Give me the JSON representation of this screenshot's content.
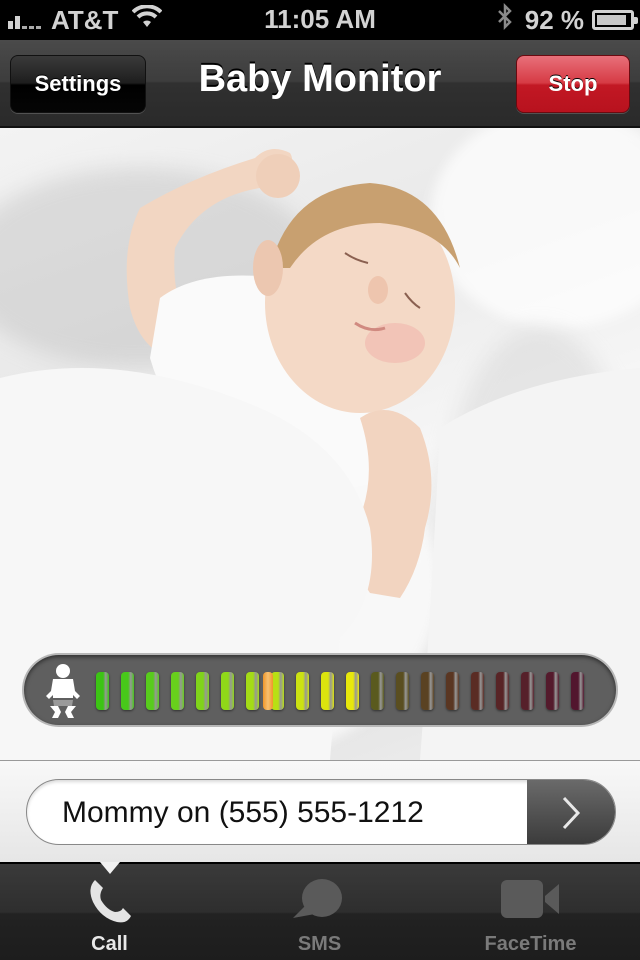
{
  "status_bar": {
    "carrier": "AT&T",
    "signal_bars_active": 2,
    "signal_bars_total": 5,
    "time": "11:05 AM",
    "battery_percent_label": "92 %",
    "battery_level": 0.92,
    "icons": [
      "signal-icon",
      "wifi-icon",
      "bluetooth-icon",
      "battery-icon"
    ]
  },
  "nav": {
    "title": "Baby Monitor",
    "left_button": "Settings",
    "right_button": "Stop",
    "stop_color": "#c21824"
  },
  "monitor": {
    "image": "sleeping-baby-photo",
    "sound_level": {
      "total_bars": 20,
      "active_bars": 11,
      "peak_bar": 7,
      "icon": "baby-icon",
      "active_colors": [
        "#3cc414",
        "#48c81a",
        "#58cc1c",
        "#68d01c",
        "#80d41a",
        "#90d818",
        "#a4dc16",
        "#b8e014",
        "#cce212",
        "#dce40e",
        "#e8e80c"
      ],
      "inactive_colors": [
        "#5a5a1e",
        "#5a4e20",
        "#5a4222",
        "#5a3622",
        "#5a2c24",
        "#582426",
        "#56202a",
        "#541a2c",
        "#52162e",
        "#561e36"
      ],
      "peak_color": "#f0962a"
    }
  },
  "contact": {
    "value": "Mommy on (555) 555-1212",
    "go_icon": "chevron-right-icon"
  },
  "tabs": [
    {
      "label": "Call",
      "icon": "phone-icon",
      "active": true
    },
    {
      "label": "SMS",
      "icon": "chat-bubble-icon",
      "active": false
    },
    {
      "label": "FaceTime",
      "icon": "video-camera-icon",
      "active": false
    }
  ]
}
